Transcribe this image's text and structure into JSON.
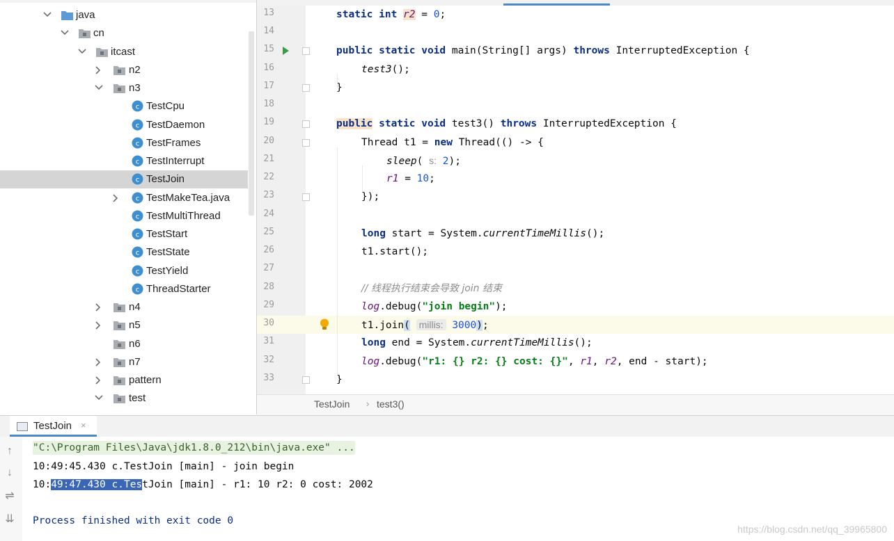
{
  "project_tree": {
    "items": [
      {
        "label": "java",
        "kind": "folder-blue",
        "expanded": true
      },
      {
        "label": "cn",
        "kind": "package",
        "expanded": true
      },
      {
        "label": "itcast",
        "kind": "package",
        "expanded": true
      },
      {
        "label": "n2",
        "kind": "package",
        "expanded": false
      },
      {
        "label": "n3",
        "kind": "package",
        "expanded": true
      },
      {
        "label": "TestCpu",
        "kind": "class"
      },
      {
        "label": "TestDaemon",
        "kind": "class"
      },
      {
        "label": "TestFrames",
        "kind": "class"
      },
      {
        "label": "TestInterrupt",
        "kind": "class"
      },
      {
        "label": "TestJoin",
        "kind": "class",
        "selected": true
      },
      {
        "label": "TestMakeTea.java",
        "kind": "class",
        "expanded": false
      },
      {
        "label": "TestMultiThread",
        "kind": "class"
      },
      {
        "label": "TestStart",
        "kind": "class"
      },
      {
        "label": "TestState",
        "kind": "class"
      },
      {
        "label": "TestYield",
        "kind": "class"
      },
      {
        "label": "ThreadStarter",
        "kind": "class"
      },
      {
        "label": "n4",
        "kind": "package",
        "expanded": false
      },
      {
        "label": "n5",
        "kind": "package",
        "expanded": false
      },
      {
        "label": "n6",
        "kind": "package"
      },
      {
        "label": "n7",
        "kind": "package",
        "expanded": false
      },
      {
        "label": "pattern",
        "kind": "package",
        "expanded": false
      },
      {
        "label": "test",
        "kind": "package",
        "expanded": true
      }
    ]
  },
  "editor": {
    "line_numbers": [
      "13",
      "14",
      "15",
      "16",
      "17",
      "18",
      "19",
      "20",
      "21",
      "22",
      "23",
      "24",
      "25",
      "26",
      "27",
      "28",
      "29",
      "30",
      "31",
      "32",
      "33"
    ],
    "current_line": "30",
    "line13": {
      "kw": "static int",
      "var": "r2",
      "rest": " = ",
      "num": "0",
      "end": ";"
    },
    "line15": {
      "kw": "public static void",
      "name": " main(String[] args) ",
      "kw2": "throws",
      "rest": " InterruptedException {"
    },
    "line16": {
      "call": "test3",
      "rest": "();"
    },
    "line17": {
      "text": "}"
    },
    "line19": {
      "kw": "public",
      "kw1": " static void",
      "name": " test3() ",
      "kw2": "throws",
      "rest": " InterruptedException {"
    },
    "line20": {
      "pre": "Thread t1 = ",
      "kw": "new",
      "rest": " Thread(() -> {"
    },
    "line21": {
      "call": "sleep",
      "open": "( ",
      "hint": "s:",
      "num": " 2",
      "end": ");"
    },
    "line22": {
      "var": "r1",
      "rest": " = ",
      "num": "10",
      "end": ";"
    },
    "line23": {
      "text": "});"
    },
    "line25": {
      "kw": "long",
      "pre": " start = System.",
      "call": "currentTimeMillis",
      "end": "();"
    },
    "line26": {
      "text": "t1.start();"
    },
    "line28": {
      "comment": "// 线程执行结束会导致 join 结束"
    },
    "line29": {
      "log": "log",
      "pre": ".debug(",
      "str": "\"join begin\"",
      "end": ");"
    },
    "line30": {
      "pre": "t1.join",
      "open": "(",
      "hint": "millis:",
      "num": "3000",
      "close": ")",
      "end": ";"
    },
    "line31": {
      "kw": "long",
      "pre": " end = System.",
      "call": "currentTimeMillis",
      "end": "();"
    },
    "line32": {
      "log": "log",
      "pre": ".debug(",
      "str": "\"r1: {} r2: {} cost: {}\"",
      "mid": ", ",
      "v1": "r1",
      "c1": ", ",
      "v2": "r2",
      "tail": ", end - start);"
    },
    "line33": {
      "text": "}"
    }
  },
  "breadcrumbs": {
    "class_name": "TestJoin",
    "separator": "›",
    "method": "test3()"
  },
  "run_panel": {
    "tab_label": "TestJoin",
    "close_glyph": "×",
    "cmd": "\"C:\\Program Files\\Java\\jdk1.8.0_212\\bin\\java.exe\" ...",
    "out1": "10:49:45.430 c.TestJoin [main] - join begin",
    "out2_a": "10:",
    "out2_sel": "49:47.430 c.Tes",
    "out2_b": "tJoin [main] - r1: 10 r2: 0 cost: 2002",
    "exit": "Process finished with exit code 0",
    "tools": [
      "up-arrow-icon",
      "down-arrow-icon",
      "soft-wrap-icon",
      "scroll-to-end-icon"
    ]
  },
  "watermark": "https://blog.csdn.net/qq_39965800",
  "colors": {
    "keyword": "#0a2d85",
    "field": "#660e7a",
    "number": "#1750eb",
    "string": "#067d17",
    "selection": "#3966b7"
  }
}
